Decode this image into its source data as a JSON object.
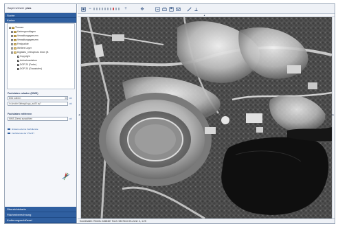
{
  "brand": {
    "prefix": "Bayernviewer",
    "suffix": "plus"
  },
  "sidebar": {
    "search_label": "Suche",
    "maps_label": "Karten",
    "layers": [
      {
        "label": "Themen",
        "kind": "root"
      },
      {
        "label": "Kartengrundlagen",
        "kind": "folder"
      },
      {
        "label": "Verwaltungsgrenzen",
        "kind": "folder"
      },
      {
        "label": "Verwaltungsgrenzen",
        "kind": "folder"
      },
      {
        "label": "Festpunkte",
        "kind": "folder"
      },
      {
        "label": "Weitere Layer",
        "kind": "folder"
      },
      {
        "label": "Digitales_Orthophoto 20cm (B",
        "kind": "folder"
      },
      {
        "label": "Copyright",
        "kind": "check",
        "checked": false
      },
      {
        "label": "Aufnahmedatum",
        "kind": "check",
        "checked": false
      },
      {
        "label": "DOP 20 (Farbe)",
        "kind": "check",
        "checked": false
      },
      {
        "label": "DOP 20 (Graustufen)",
        "kind": "check",
        "checked": true
      }
    ],
    "add_section_title": "Fachdaten zuladen (WMS)",
    "add_select_value": "Bitte wählen",
    "add_select_btn": "ok",
    "add_url_value": "In Ansicht übtragt logo_aw20.xy?",
    "add_url_btn": "ok",
    "remove_section_title": "Fachdaten entfernen",
    "remove_select_value": "WMS-Dienst auswählen",
    "remove_btn": "ok",
    "links": [
      "Hinweis externe Fachdienste",
      "Fachdienste der VSV-BY"
    ],
    "bottom_panels": [
      "Übersichtskarte",
      "Flächenberechnung",
      "Kodierungsschlüssel"
    ]
  },
  "status": {
    "text": "Koordinaten: Rechts: 4468487 Hoch: 5337613 GK-Zone: 4, 1:25"
  },
  "icons": {
    "home": "home-icon",
    "zoom_in": "zoom-in-icon",
    "zoom_out": "zoom-out-icon",
    "pan": "pan-icon",
    "info": "info-icon",
    "print": "print-icon",
    "measure": "measure-icon",
    "help": "help-icon"
  },
  "colors": {
    "header_blue": "#2f5fa0",
    "panel_bg": "#f4f6fa"
  }
}
